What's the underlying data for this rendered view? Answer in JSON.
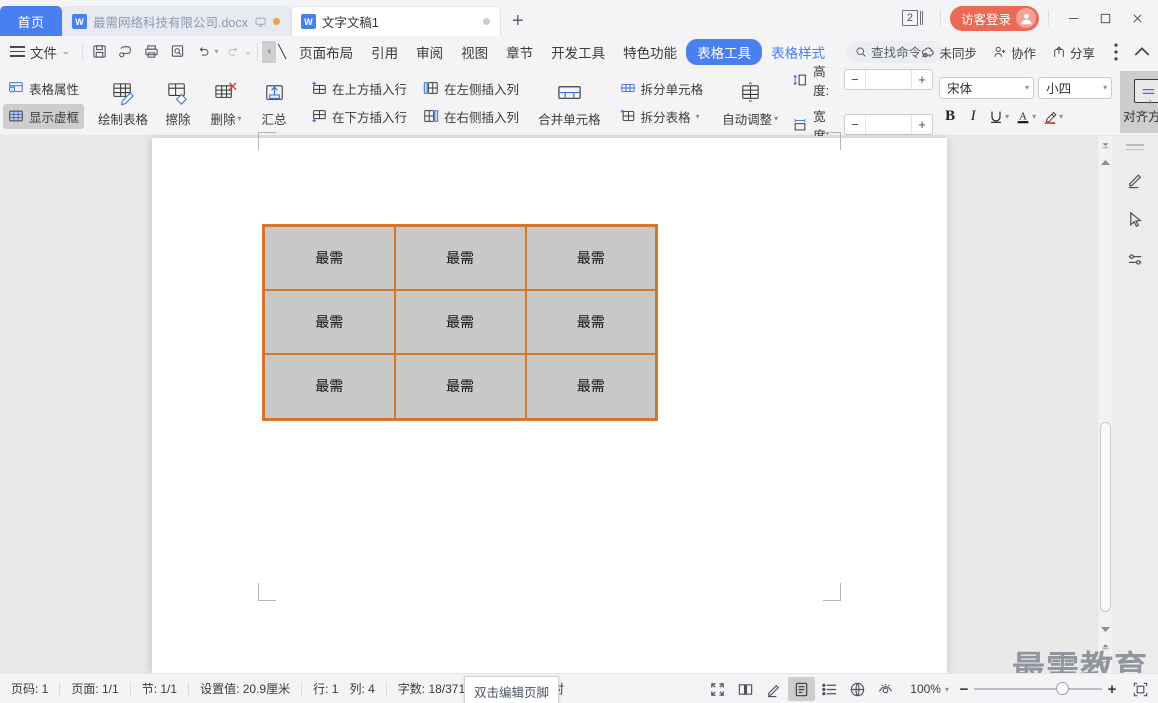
{
  "titlebar": {
    "home_tab": "首页",
    "tabs": [
      {
        "name": "最需网络科技有限公司.docx",
        "active": false
      },
      {
        "name": "文字文稿1",
        "active": true
      }
    ],
    "new_tab": "+",
    "page_count_badge": "2",
    "login_label": "访客登录",
    "window_minimize": "–",
    "window_maximize": "□",
    "window_close": "✕"
  },
  "menubar": {
    "file_label": "文件",
    "items": [
      "页面布局",
      "引用",
      "审阅",
      "视图",
      "章节",
      "开发工具",
      "特色功能"
    ],
    "active_tool": "表格工具",
    "sub_tool": "表格样式",
    "search_placeholder": "查找命令...",
    "right_items": [
      {
        "label": "未同步",
        "icon": "cloud-sync-icon"
      },
      {
        "label": "协作",
        "icon": "collaborate-icon"
      },
      {
        "label": "分享",
        "icon": "share-icon"
      }
    ],
    "more_icon": "more-vertical-icon",
    "collapse_icon": "chevron-up-icon"
  },
  "ribbon": {
    "table_properties": "表格属性",
    "show_gridlines": "显示虚框",
    "draw_table": "绘制表格",
    "eraser": "擦除",
    "delete": "删除",
    "sum": "汇总",
    "insert_row_above": "在上方插入行",
    "insert_row_below": "在下方插入行",
    "insert_col_left": "在左侧插入列",
    "insert_col_right": "在右侧插入列",
    "merge_cells": "合并单元格",
    "split_cell": "拆分单元格",
    "split_table": "拆分表格",
    "auto_fit": "自动调整",
    "height_label": "高度:",
    "height_value": "",
    "width_label": "宽度:",
    "width_value": "",
    "font_name": "宋体",
    "font_size": "小四",
    "bold": "B",
    "italic": "I",
    "underline": "U",
    "font_color": "A",
    "highlight": "highlight",
    "align_label": "对齐方式"
  },
  "document": {
    "table": {
      "rows": [
        [
          "最需",
          "最需",
          "最需"
        ],
        [
          "最需",
          "最需",
          "最需"
        ],
        [
          "最需",
          "最需",
          "最需"
        ]
      ],
      "border_color": "#d2772b",
      "cell_fill": "#c8c8c8"
    },
    "watermark": "最需教育"
  },
  "right_strip": {
    "pen_icon": "pen-highlight-icon",
    "select_icon": "cursor-select-icon",
    "settings_icon": "sliders-icon"
  },
  "statusbar": {
    "page_number": "页码: 1",
    "page_total": "页面: 1/1",
    "section": "节: 1/1",
    "setting_value": "设置值: 20.9厘米",
    "row": "行: 1",
    "column": "列: 4",
    "word_count": "字数: 18/371",
    "proofread": "文档校对",
    "tooltip": "双击编辑页脚",
    "zoom": "100%",
    "view_buttons": [
      {
        "name": "fullscreen-icon",
        "active": false
      },
      {
        "name": "book-view-icon",
        "active": false
      },
      {
        "name": "pen-view-icon",
        "active": false
      },
      {
        "name": "page-view-icon",
        "active": true
      },
      {
        "name": "outline-view-icon",
        "active": false
      },
      {
        "name": "web-view-icon",
        "active": false
      },
      {
        "name": "eye-view-icon",
        "active": false
      }
    ]
  },
  "colors": {
    "accent_blue": "#4a7ff0",
    "login_red": "#eb6a56",
    "table_border": "#d2772b",
    "table_fill": "#c8c8c8"
  }
}
